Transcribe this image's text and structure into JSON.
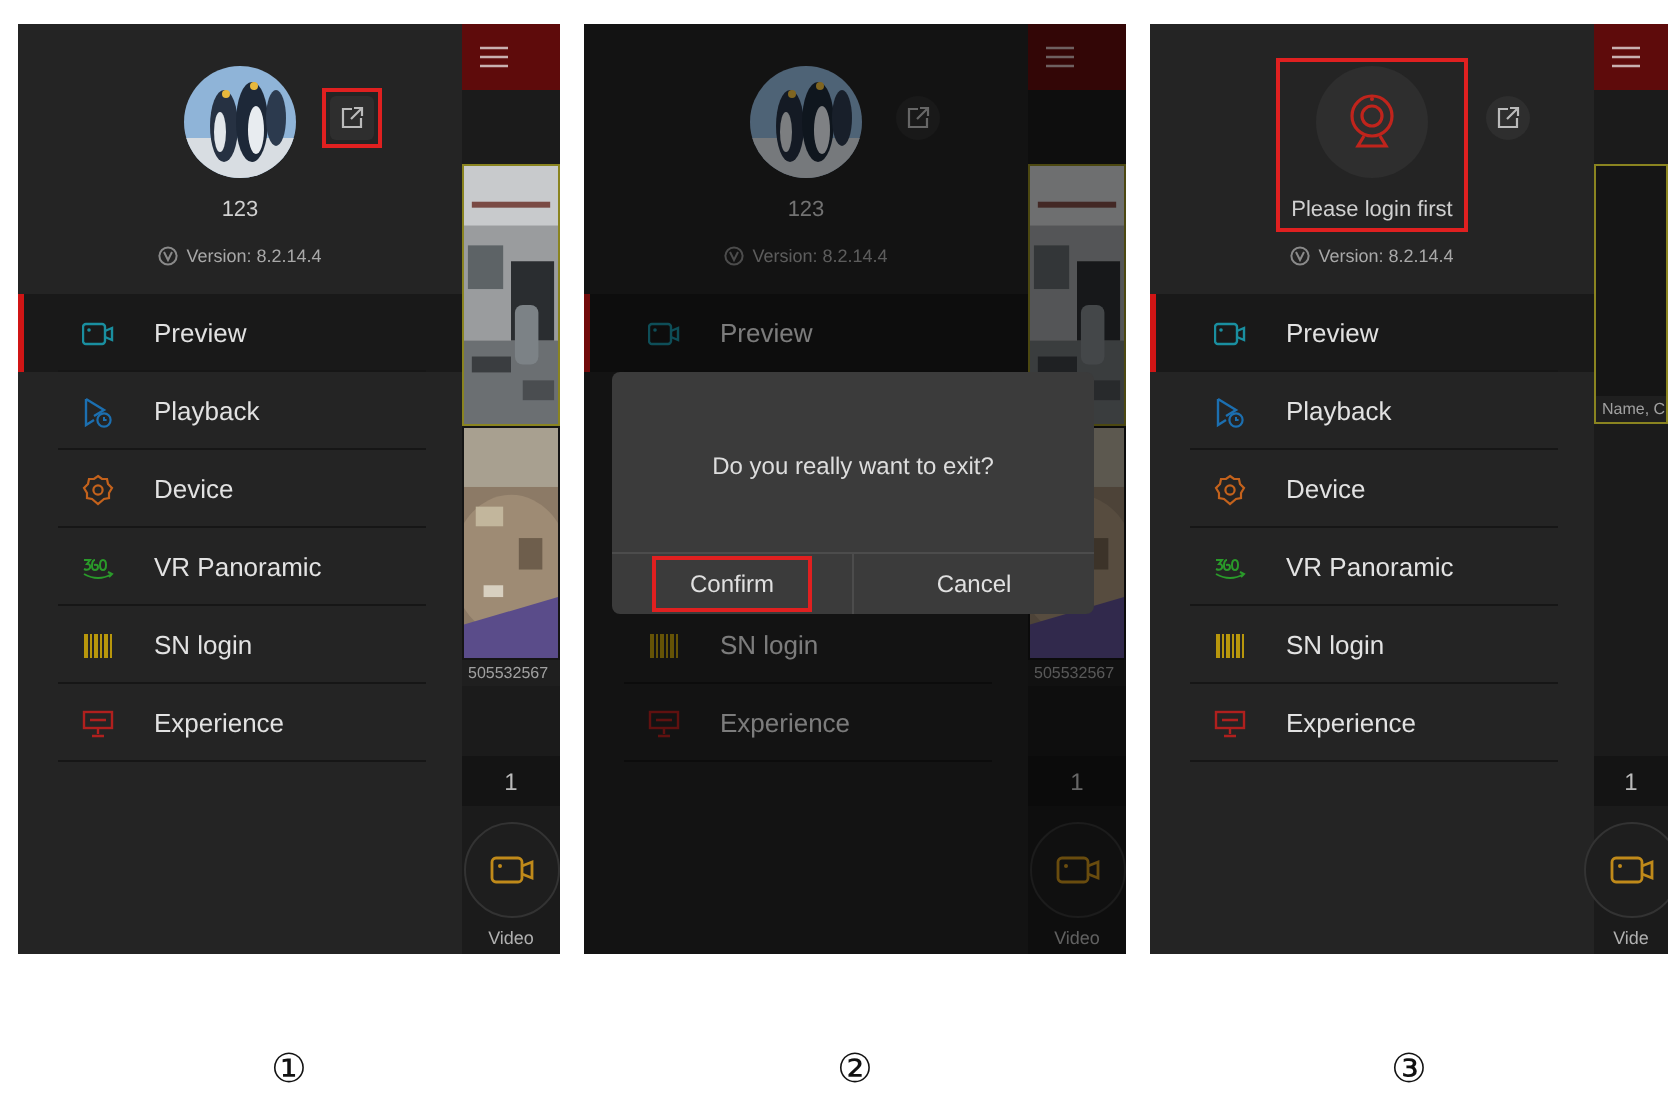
{
  "screens": [
    {
      "caption": "①",
      "dimmed": false,
      "profile": {
        "kind": "avatar",
        "name": "123",
        "highlighted": false
      },
      "logout": {
        "highlighted": true
      },
      "version": "Version: 8.2.14.4",
      "menu": [
        {
          "label": "Preview",
          "kind": "camera",
          "selected": true
        },
        {
          "label": "Playback",
          "kind": "playback",
          "selected": false
        },
        {
          "label": "Device",
          "kind": "gear",
          "selected": false
        },
        {
          "label": "VR Panoramic",
          "kind": "vr",
          "selected": false
        },
        {
          "label": "SN login",
          "kind": "barcode",
          "selected": false
        },
        {
          "label": "Experience",
          "kind": "screen",
          "selected": false
        }
      ],
      "strip": {
        "frames": [
          {
            "kind": "camera",
            "selected": true
          },
          {
            "kind": "floor",
            "selected": false,
            "label": "505532567"
          }
        ],
        "counter": "1",
        "video_label": "Video"
      }
    },
    {
      "caption": "②",
      "dimmed": true,
      "profile": {
        "kind": "avatar",
        "name": "123",
        "highlighted": false
      },
      "logout": {
        "highlighted": false
      },
      "version": "Version: 8.2.14.4",
      "menu": [
        {
          "label": "Preview",
          "kind": "camera",
          "selected": true
        },
        {
          "label": "SN login",
          "kind": "barcode",
          "selected": false
        },
        {
          "label": "Experience",
          "kind": "screen",
          "selected": false
        }
      ],
      "strip": {
        "frames": [
          {
            "kind": "camera",
            "selected": true
          },
          {
            "kind": "floor",
            "selected": false,
            "label": "505532567"
          }
        ],
        "counter": "1",
        "video_label": "Video"
      },
      "dialog": {
        "message": "Do you really want to exit?",
        "buttons": [
          {
            "label": "Confirm",
            "highlighted": true
          },
          {
            "label": "Cancel",
            "highlighted": false
          }
        ]
      }
    },
    {
      "caption": "③",
      "dimmed": false,
      "profile": {
        "kind": "login",
        "name": "Please login first",
        "highlighted": true
      },
      "logout": {
        "highlighted": false
      },
      "version": "Version: 8.2.14.4",
      "menu": [
        {
          "label": "Preview",
          "kind": "camera",
          "selected": true
        },
        {
          "label": "Playback",
          "kind": "playback",
          "selected": false
        },
        {
          "label": "Device",
          "kind": "gear",
          "selected": false
        },
        {
          "label": "VR Panoramic",
          "kind": "vr",
          "selected": false
        },
        {
          "label": "SN login",
          "kind": "barcode",
          "selected": false
        },
        {
          "label": "Experience",
          "kind": "screen",
          "selected": false
        }
      ],
      "strip": {
        "frames": [
          {
            "kind": "empty",
            "selected": true,
            "label": "Name, C"
          }
        ],
        "counter": "1",
        "video_label": "Vide"
      }
    }
  ]
}
